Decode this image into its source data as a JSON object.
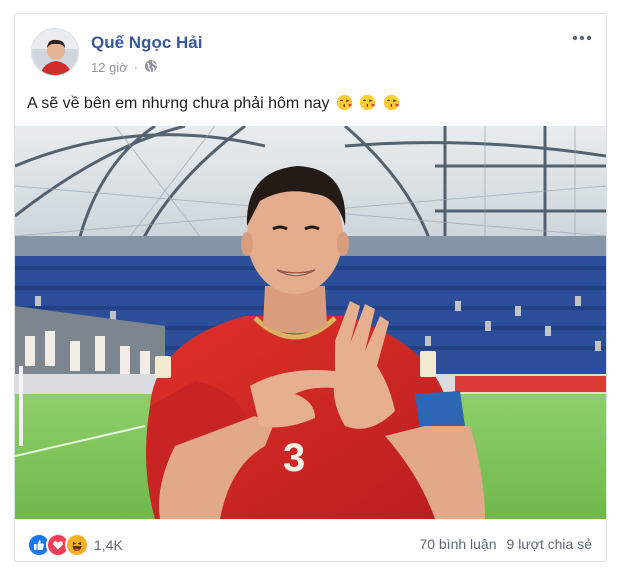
{
  "post": {
    "author": "Quế Ngọc Hải",
    "time": "12 giờ",
    "privacy_icon": "globe-icon",
    "text": "A sẽ về bên em nhưng chưa phải hôm nay",
    "emojis": [
      "kissing-heart-emoji",
      "kissing-heart-emoji",
      "kissing-heart-emoji"
    ]
  },
  "reactions": {
    "icons": [
      "like-icon",
      "love-icon",
      "haha-icon"
    ],
    "count": "1,4K"
  },
  "stats": {
    "comments": "70 bình luận",
    "shares": "9 lượt chia sẻ"
  },
  "colors": {
    "name_link": "#385898",
    "meta_gray": "#90949c",
    "like_blue": "#1877f2",
    "love_red": "#f33e58",
    "haha_yellow": "#f7b125"
  }
}
